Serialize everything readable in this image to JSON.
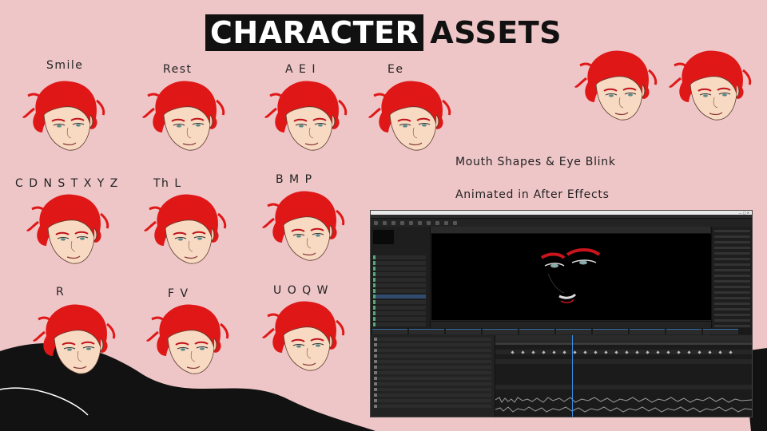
{
  "title": {
    "highlighted": "CHARACTER",
    "plain": "ASSETS"
  },
  "mouth_shapes": [
    {
      "label": "Smile"
    },
    {
      "label": "Rest"
    },
    {
      "label": "A E I"
    },
    {
      "label": "Ee"
    },
    {
      "label": "C D N S T X Y Z"
    },
    {
      "label": "Th L"
    },
    {
      "label": "B M P"
    },
    {
      "label": "R"
    },
    {
      "label": "F V"
    },
    {
      "label": "U O Q W"
    }
  ],
  "captions": {
    "blink": "Mouth Shapes & Eye Blink",
    "animated": "Animated in After Effects"
  },
  "colors": {
    "background": "#efc6c8",
    "hair": "#e01717",
    "skin": "#f8d9c2",
    "title_box": "#111111"
  }
}
